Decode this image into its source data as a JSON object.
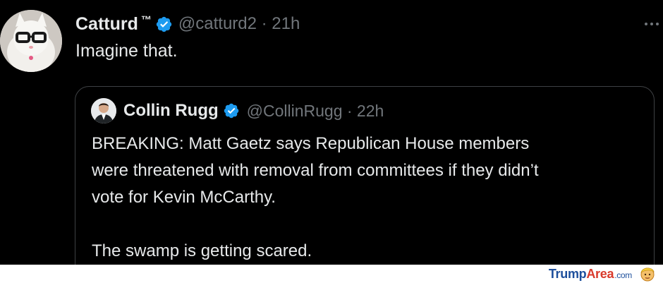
{
  "tweet": {
    "display_name": "Catturd",
    "tm": "™",
    "handle_time": "@catturd2 · 21h",
    "text": "Imagine that."
  },
  "quoted": {
    "display_name": "Collin Rugg",
    "handle_time": "@CollinRugg · 22h",
    "body": "BREAKING: Matt Gaetz says Republican House members\nwere threatened with removal from committees if they didn’t\nvote for Kevin McCarthy.\n\nThe swamp is getting scared."
  },
  "watermark": {
    "part1": "Trump",
    "part2": "Area",
    "part3": ".com"
  },
  "colors": {
    "background": "#000000",
    "text": "#e7e9ea",
    "muted": "#71767b",
    "verified": "#1d9bf0"
  },
  "icons": {
    "verified": "verified-badge-icon",
    "more": "more-options-icon",
    "watermark": "trump-face-icon"
  }
}
